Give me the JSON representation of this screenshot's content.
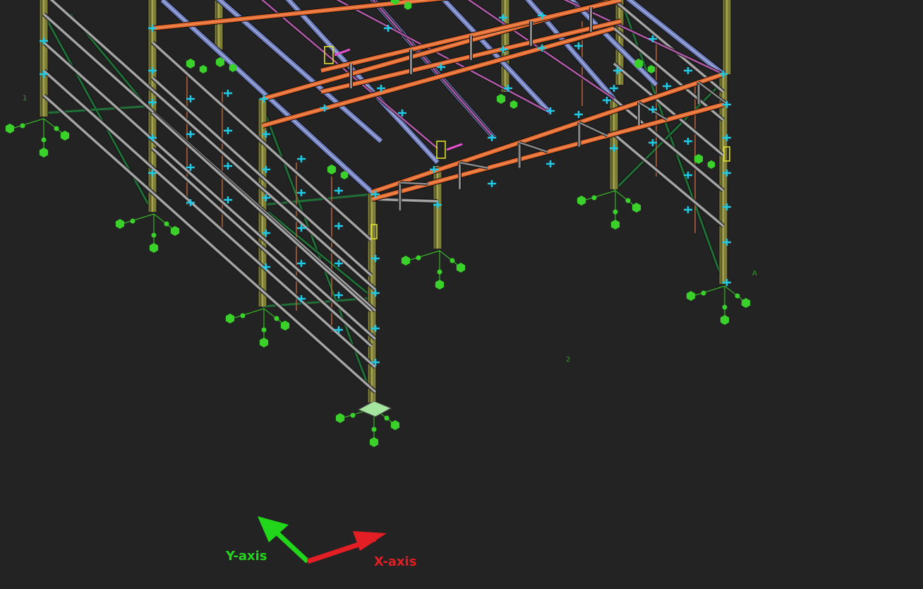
{
  "viewport": {
    "background": "#232323"
  },
  "axes": {
    "x": {
      "label": "X-axis",
      "color": "#e31e24"
    },
    "y": {
      "label": "Y-axis",
      "color": "#22d61c"
    }
  },
  "colors": {
    "column": "#7f7f3a",
    "rafter": "#e56a2f",
    "purlin": "#6f7fc0",
    "purlin_edge": "#c9cce6",
    "girt": "#8a8a8a",
    "brace": "#1f6f37",
    "roof_brace": "#b05aa8",
    "sag_rod": "#b4613a",
    "connection": "#1ecbe6",
    "support": "#3ad12a",
    "base_plate": "#a4e6a0"
  },
  "icons": {
    "support": "fixed-support-icon",
    "connection": "connection-marker-icon",
    "origin": "axis-triad-icon"
  }
}
